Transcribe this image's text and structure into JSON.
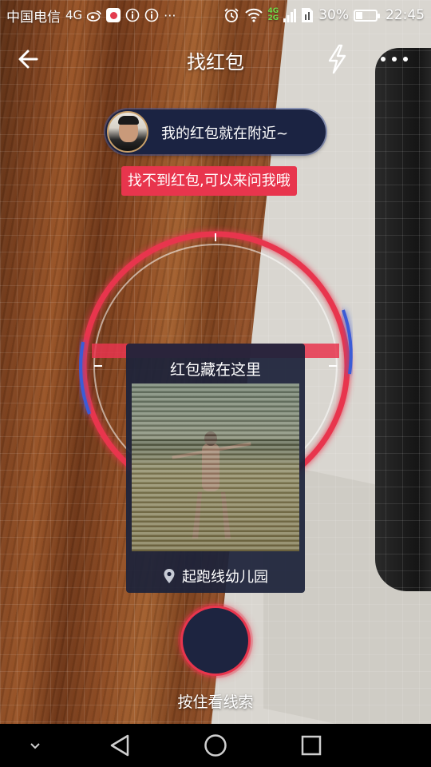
{
  "status_bar": {
    "carrier": "中国电信",
    "network": "4G",
    "net_badge_top": "4G",
    "net_badge_bottom": "2G",
    "battery_percent": "30%",
    "battery_level": 0.3,
    "time": "22:45",
    "icons": [
      "weibo-icon",
      "app-notification-icon",
      "info-icon",
      "info-icon",
      "more-notifications-icon",
      "alarm-icon",
      "wifi-icon",
      "signal-icon",
      "sim-icon",
      "battery-icon"
    ]
  },
  "header": {
    "title": "找红包",
    "back_icon": "arrow-left-icon",
    "flash_icon": "lightning-icon",
    "more_icon": "ellipsis-icon"
  },
  "speech": {
    "text": "我的红包就在附近~"
  },
  "hint": {
    "text": "找不到红包,可以来问我哦"
  },
  "clue_card": {
    "title": "红包藏在这里",
    "location": "起跑线幼儿园",
    "location_icon": "location-pin-icon"
  },
  "hold_button": {
    "label": "按住看线索"
  },
  "nav_bar": {
    "items": [
      "chevron-down-icon",
      "back-triangle-icon",
      "home-circle-icon",
      "recents-square-icon"
    ]
  },
  "colors": {
    "accent_red": "#e8354d",
    "panel_navy": "#1b2342"
  }
}
